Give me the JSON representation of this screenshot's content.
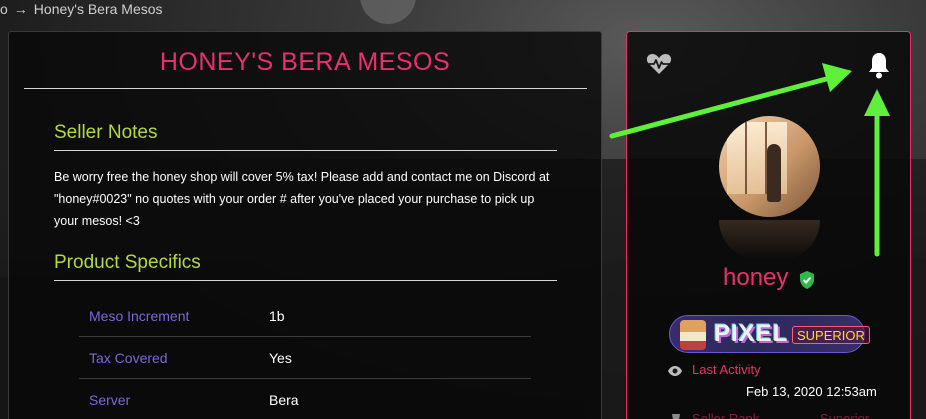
{
  "breadcrumb": {
    "prev": "o",
    "separator": "→",
    "current": "Honey's Bera Mesos"
  },
  "listing": {
    "title": "HONEY'S BERA MESOS",
    "seller_notes_heading": "Seller Notes",
    "seller_notes_lines": [
      "Be worry free the honey shop will cover 5% tax! Please add and contact me on Discord at",
      "\"honey#0023\" no quotes with your order # after you've placed your purchase to pick up",
      "your mesos! <3"
    ],
    "specifics_heading": "Product Specifics",
    "specifics": [
      {
        "label": "Meso Increment",
        "value": "1b"
      },
      {
        "label": "Tax Covered",
        "value": "Yes"
      },
      {
        "label": "Server",
        "value": "Bera"
      }
    ]
  },
  "seller": {
    "username": "honey",
    "rank_word": "PIXEL",
    "rank_tier": "SUPERIOR",
    "last_activity_label": "Last Activity",
    "last_activity_value": "Feb 13, 2020 12:53am",
    "seller_rank_label": "Seller Rank",
    "seller_rank_value": "Superior"
  },
  "icons": {
    "favorite": "heart-pulse-icon",
    "notify": "bell-icon",
    "verified": "shield-check-icon",
    "activity": "eye-icon",
    "rank": "trophy-icon"
  },
  "colors": {
    "accent": "#e8306e",
    "section_heading": "#b5d842",
    "spec_label": "#7a68d8",
    "annotation_arrow": "#5ef03a"
  }
}
